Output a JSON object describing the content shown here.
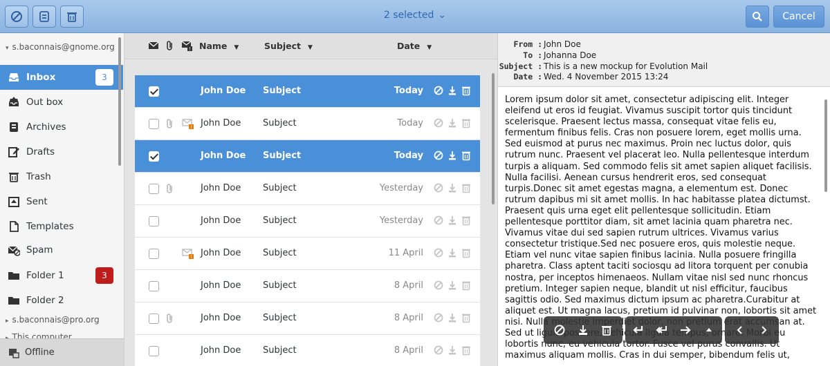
{
  "header": {
    "title": "2 selected",
    "cancel_label": "Cancel",
    "accent": "#4a90d9"
  },
  "sidebar": {
    "account_primary": "s.baconnais@gnome.org",
    "folders": [
      {
        "label": "Inbox",
        "icon": "inbox-icon",
        "badge": "3",
        "active": true
      },
      {
        "label": "Out box",
        "icon": "outbox-icon"
      },
      {
        "label": "Archives",
        "icon": "archive-icon"
      },
      {
        "label": "Drafts",
        "icon": "drafts-icon"
      },
      {
        "label": "Trash",
        "icon": "trash-icon"
      },
      {
        "label": "Sent",
        "icon": "sent-icon"
      },
      {
        "label": "Templates",
        "icon": "templates-icon"
      },
      {
        "label": "Spam",
        "icon": "spam-icon"
      },
      {
        "label": "Folder 1",
        "icon": "folder-icon",
        "badge": "3"
      },
      {
        "label": "Folder 2",
        "icon": "folder-icon"
      }
    ],
    "account_secondary": "s.baconnais@pro.org",
    "account_local": "This computer",
    "status": "Offline"
  },
  "list": {
    "columns": {
      "name": "Name",
      "subject": "Subject",
      "date": "Date"
    },
    "rows": [
      {
        "name": "John Doe",
        "subject": "Subject",
        "date": "Today",
        "selected": true,
        "attachment": false,
        "flag": false
      },
      {
        "name": "John Doe",
        "subject": "Subject",
        "date": "Today",
        "selected": false,
        "attachment": true,
        "flag": true
      },
      {
        "name": "John Doe",
        "subject": "Subject",
        "date": "Today",
        "selected": true,
        "attachment": false,
        "flag": false
      },
      {
        "name": "John Doe",
        "subject": "Subject",
        "date": "Yesterday",
        "selected": false,
        "attachment": true,
        "flag": false
      },
      {
        "name": "John Doe",
        "subject": "Subject",
        "date": "Yesterday",
        "selected": false,
        "attachment": false,
        "flag": false
      },
      {
        "name": "John Doe",
        "subject": "Subject",
        "date": "11 April",
        "selected": false,
        "attachment": false,
        "flag": true
      },
      {
        "name": "John Doe",
        "subject": "Subject",
        "date": "8 April",
        "selected": false,
        "attachment": false,
        "flag": false
      },
      {
        "name": "John Doe",
        "subject": "Subject",
        "date": "8 April",
        "selected": false,
        "attachment": true,
        "flag": false
      },
      {
        "name": "John Doe",
        "subject": "Subject",
        "date": "8 April",
        "selected": false,
        "attachment": false,
        "flag": false
      }
    ]
  },
  "preview": {
    "from_label": "From :",
    "from": "John Doe",
    "to_label": "To :",
    "to": "Johanna Doe",
    "subject_label": "Subject :",
    "subject": "This is a new mockup for Evolution Mail",
    "date_label": "Date :",
    "date": "Wed. 4 November 2015 13:24",
    "body": "Lorem ipsum dolor sit amet, consectetur adipiscing elit. Integer eleifend ut eros id feugiat. Vivamus suscipit tortor quis tincidunt scelerisque. Praesent lectus massa, consequat vitae felis eu, fermentum finibus felis. Cras non posuere lorem, eget mollis urna. Sed euismod at purus nec maximus. Proin nec luctus dolor, quis rutrum nunc. Praesent vel placerat leo. Nulla pellentesque interdum turpis a aliquam. Sed commodo felis sit amet sapien aliquet facilisis. Nulla facilisi. Aenean cursus hendrerit eros, sed consequat turpis.Donec sit amet egestas magna, a elementum est. Donec rutrum dapibus mi sit amet mollis. In hac habitasse platea dictumst. Praesent quis urna eget elit pellentesque sollicitudin. Etiam pellentesque porttitor diam, sit amet lacinia quam pharetra nec. Vivamus vitae dui sed sapien rutrum ultrices. Vivamus varius consectetur tristique.Sed nec posuere eros, quis molestie neque. Etiam vel nunc vitae sapien finibus lacinia. Nulla posuere fringilla pharetra. Class aptent taciti sociosqu ad litora torquent per conubia nostra, per inceptos himenaeos. Nullam vitae nisl sed nunc rhoncus pretium. Integer sapien neque, blandit ut nisl efficitur, faucibus sagittis odio. Sed maximus dictum ipsum ac pharetra.Curabitur at aliquet est. Ut magna lacus, pretium id pulvinar non, lobortis sit amet nisi. Nulla molestie imperdiet dolor, non pretium erat accumsan at. Sed ut ligula posuere, vehicula ligula tempus, ornare. Morbi eu lobortis nunc, eu vehicula tortor. Fusce vel purus convallis. Ut maximus aliquam mollis. Cras in dui semper, bibendum felis ut,"
  },
  "floating_toolbar": [
    "junk-icon",
    "archive-download-icon",
    "trash-icon",
    "reply-icon",
    "reply-all-icon",
    "forward-icon",
    "up-icon",
    "previous-icon",
    "next-icon"
  ]
}
